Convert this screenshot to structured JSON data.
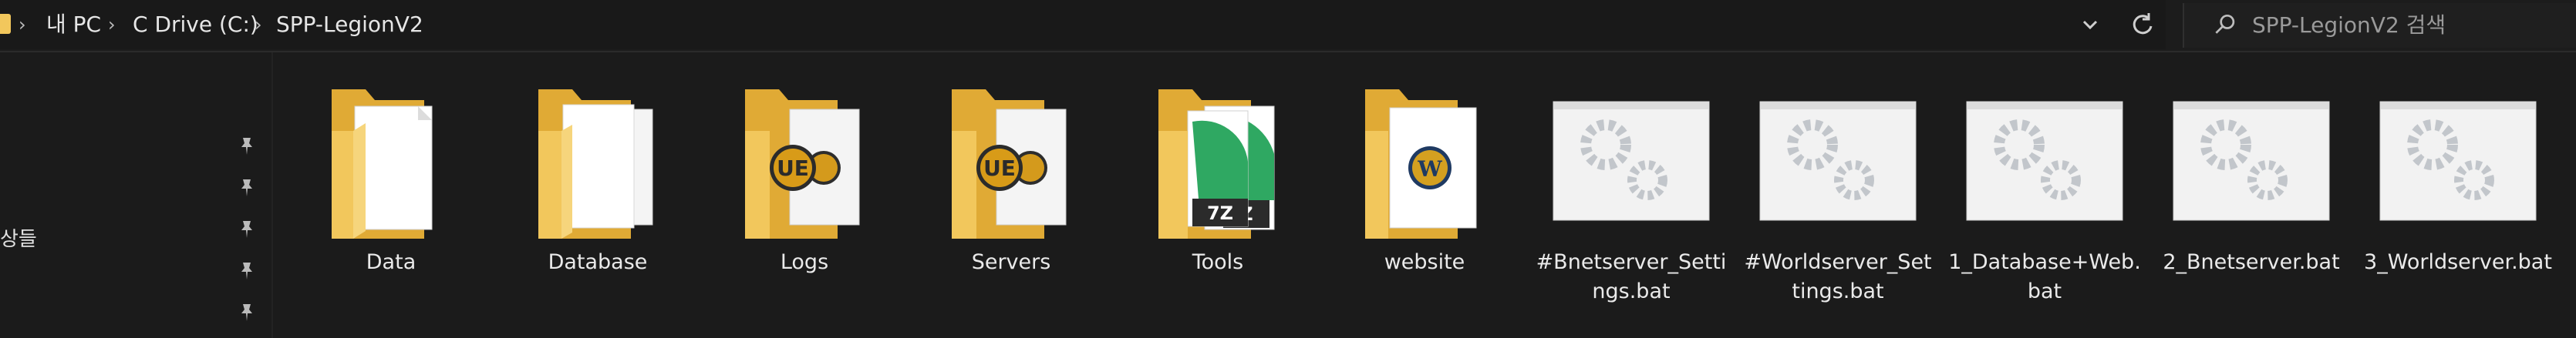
{
  "address_bar": {
    "crumbs": [
      "내 PC",
      "C Drive (C:)",
      "SPP-LegionV2"
    ]
  },
  "search": {
    "placeholder": "SPP-LegionV2 검색"
  },
  "nav": {
    "partial_label": "상들"
  },
  "items": [
    {
      "name": "Data",
      "type": "folder",
      "badge": "none"
    },
    {
      "name": "Database",
      "type": "folder",
      "badge": "ue"
    },
    {
      "name": "Logs",
      "type": "folder",
      "badge": "ue"
    },
    {
      "name": "Servers",
      "type": "folder",
      "badge": "ue"
    },
    {
      "name": "Tools",
      "type": "folder",
      "badge": "7z"
    },
    {
      "name": "website",
      "type": "folder",
      "badge": "wow"
    },
    {
      "name": "#Bnetserver_Settings.bat",
      "type": "bat",
      "badge": "gears"
    },
    {
      "name": "#Worldserver_Settings.bat",
      "type": "bat",
      "badge": "gears"
    },
    {
      "name": "1_Database+Web.bat",
      "type": "bat",
      "badge": "gears"
    },
    {
      "name": "2_Bnetserver.bat",
      "type": "bat",
      "badge": "gears"
    },
    {
      "name": "3_Worldserver.bat",
      "type": "bat",
      "badge": "gears"
    }
  ],
  "colors": {
    "background": "#1b1b1b",
    "folder": "#f2c75c",
    "folder_dark": "#e0aa35",
    "text": "#eaeaea"
  }
}
